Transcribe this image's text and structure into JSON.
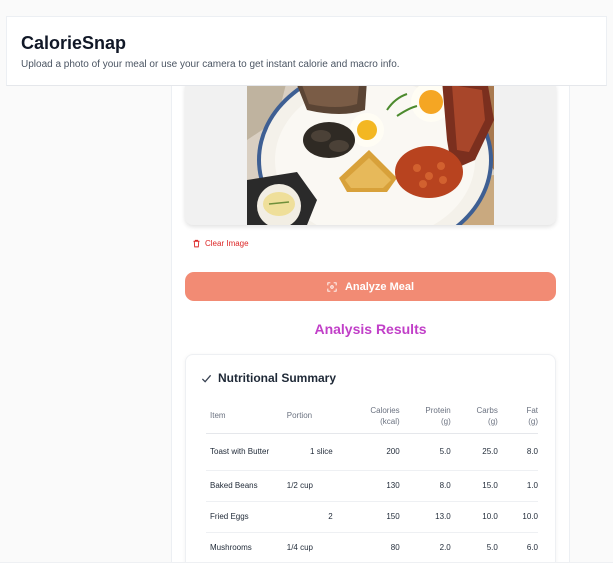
{
  "header": {
    "title": "CalorieSnap",
    "subtitle": "Upload a photo of your meal or use your camera to get instant calorie and macro info."
  },
  "upload": {
    "clear_label": "Clear Image",
    "analyze_label": "Analyze Meal"
  },
  "results": {
    "title": "Analysis Results",
    "summary_heading": "Nutritional Summary",
    "columns": {
      "item": "Item",
      "portion": "Portion",
      "calories": "Calories\n(kcal)",
      "protein": "Protein\n(g)",
      "carbs": "Carbs\n(g)",
      "fat": "Fat\n(g)"
    },
    "rows": [
      {
        "item": "Toast with Butter",
        "portion": "1 slice",
        "calories": "200",
        "protein": "5.0",
        "carbs": "25.0",
        "fat": "8.0"
      },
      {
        "item": "Baked Beans",
        "portion": "1/2 cup",
        "calories": "130",
        "protein": "8.0",
        "carbs": "15.0",
        "fat": "1.0"
      },
      {
        "item": "Fried Eggs",
        "portion": "2",
        "calories": "150",
        "protein": "13.0",
        "carbs": "10.0",
        "fat": "10.0"
      },
      {
        "item": "Mushrooms",
        "portion": "1/4 cup",
        "calories": "80",
        "protein": "2.0",
        "carbs": "5.0",
        "fat": "6.0"
      }
    ]
  },
  "colors": {
    "accent": "#f28b74",
    "results_title": "#c13fc8",
    "danger": "#dc2626"
  },
  "icons": {
    "clear": "trash-icon",
    "analyze": "scan-icon",
    "summary": "check-icon"
  }
}
